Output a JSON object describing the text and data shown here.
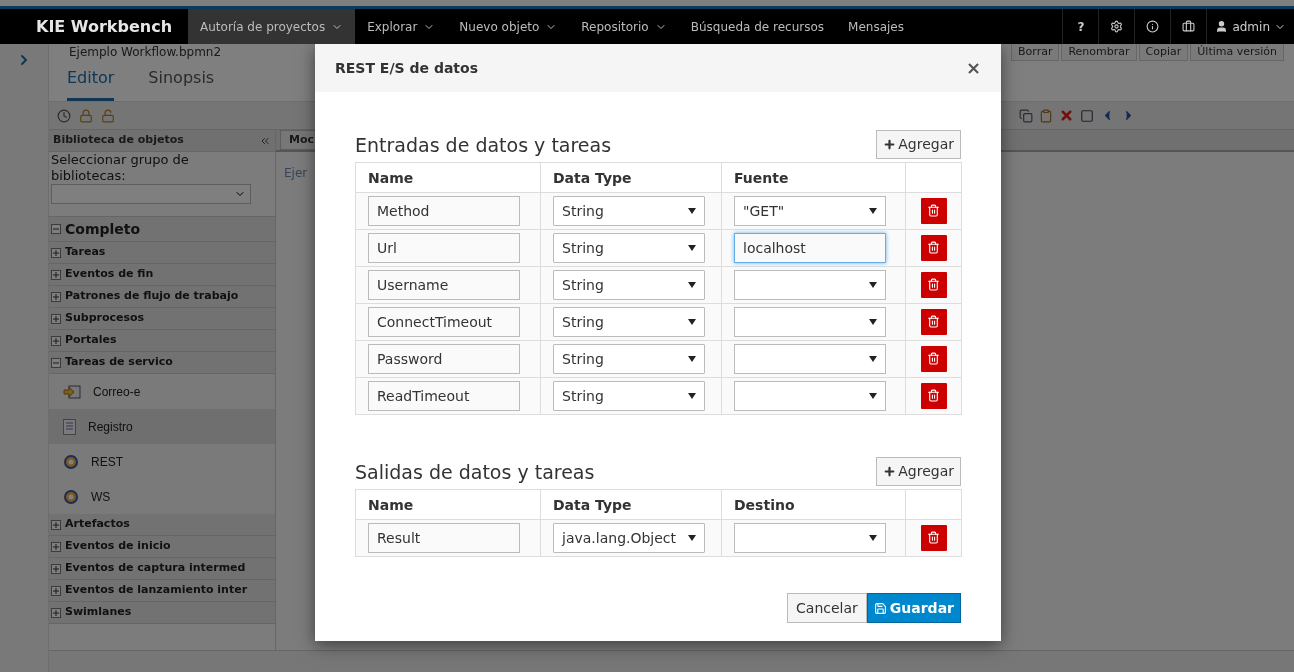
{
  "navbar": {
    "brand": "KIE Workbench",
    "menus": [
      {
        "label": "Autoría de proyectos",
        "selected": true,
        "dropdown": true
      },
      {
        "label": "Explorar",
        "selected": false,
        "dropdown": true
      },
      {
        "label": "Nuevo objeto",
        "selected": false,
        "dropdown": true
      },
      {
        "label": "Repositorio",
        "selected": false,
        "dropdown": true
      },
      {
        "label": "Búsqueda de recursos",
        "selected": false,
        "dropdown": false
      },
      {
        "label": "Mensajes",
        "selected": false,
        "dropdown": false
      }
    ],
    "help": "?",
    "user": "admin"
  },
  "document": {
    "title": "Ejemplo Workflow.bpmn2",
    "actions": [
      "Borrar",
      "Renombrar",
      "Copiar",
      "Última versión"
    ]
  },
  "tabs": [
    {
      "label": "Editor",
      "selected": true
    },
    {
      "label": "Sinopsis",
      "selected": false
    }
  ],
  "library": {
    "title": "Biblioteca de objetos",
    "group_label": "Seleccionar grupo de bibliotecas:",
    "root": {
      "label": "Completo",
      "expanded": true
    },
    "sections": [
      {
        "label": "Tareas",
        "expanded": false
      },
      {
        "label": "Eventos de fin",
        "expanded": false
      },
      {
        "label": "Patrones de flujo de trabajo",
        "expanded": false
      },
      {
        "label": "Subprocesos",
        "expanded": false
      },
      {
        "label": "Portales",
        "expanded": false
      },
      {
        "label": "Tareas de servico",
        "expanded": true,
        "children": [
          {
            "label": "Correo-e",
            "kind": "mail",
            "selected": false
          },
          {
            "label": "Registro",
            "kind": "log",
            "selected": true
          },
          {
            "label": "REST",
            "kind": "service",
            "selected": false
          },
          {
            "label": "WS",
            "kind": "service",
            "selected": false
          }
        ]
      },
      {
        "label": "Artefactos",
        "expanded": false
      },
      {
        "label": "Eventos de inicio",
        "expanded": false
      },
      {
        "label": "Eventos de captura intermed",
        "expanded": false
      },
      {
        "label": "Eventos de lanzamiento inter",
        "expanded": false
      },
      {
        "label": "Swimlanes",
        "expanded": false
      }
    ]
  },
  "canvas": {
    "tab": "Moc",
    "text": "Ejer"
  },
  "dialog": {
    "title": "REST E/S de datos",
    "close": "×",
    "inputs": {
      "title": "Entradas de datos y tareas",
      "add": "Agregar",
      "columns": [
        "Name",
        "Data Type",
        "Fuente"
      ],
      "rows": [
        {
          "name": "Method",
          "type": "String",
          "source": "\"GET\"",
          "kind": "select",
          "focused": false
        },
        {
          "name": "Url",
          "type": "String",
          "source": "localhost",
          "kind": "text",
          "focused": true
        },
        {
          "name": "Username",
          "type": "String",
          "kind": "select",
          "focused": false
        },
        {
          "name": "ConnectTimeout",
          "type": "String",
          "kind": "select",
          "focused": false
        },
        {
          "name": "Password",
          "type": "String",
          "kind": "select",
          "focused": false
        },
        {
          "name": "ReadTimeout",
          "type": "String",
          "kind": "select",
          "focused": false
        }
      ]
    },
    "outputs": {
      "title": "Salidas de datos y tareas",
      "add": "Agregar",
      "columns": [
        "Name",
        "Data Type",
        "Destino"
      ],
      "rows": [
        {
          "name": "Result",
          "type": "java.lang.Object",
          "kind": "select",
          "focused": false
        }
      ]
    },
    "cancel": "Cancelar",
    "save": "Guardar"
  }
}
